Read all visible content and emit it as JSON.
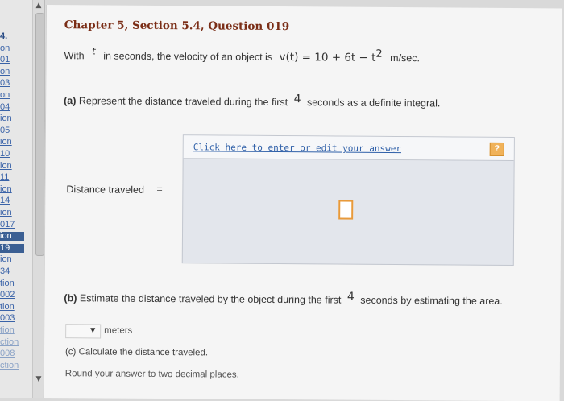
{
  "left_nav": {
    "items": [
      {
        "label": "4.",
        "state": "plain"
      },
      {
        "label": "on",
        "state": "link"
      },
      {
        "label": "01",
        "state": "link"
      },
      {
        "label": "on",
        "state": "link"
      },
      {
        "label": "03",
        "state": "link"
      },
      {
        "label": "on",
        "state": "link"
      },
      {
        "label": "04",
        "state": "link"
      },
      {
        "label": "ion",
        "state": "link"
      },
      {
        "label": "05",
        "state": "link"
      },
      {
        "label": "ion",
        "state": "link"
      },
      {
        "label": "10",
        "state": "link"
      },
      {
        "label": "ion",
        "state": "link"
      },
      {
        "label": "11",
        "state": "link"
      },
      {
        "label": "ion",
        "state": "link"
      },
      {
        "label": "14",
        "state": "link"
      },
      {
        "label": "ion",
        "state": "link"
      },
      {
        "label": "017",
        "state": "link"
      },
      {
        "label": "ion",
        "state": "active"
      },
      {
        "label": "19",
        "state": "active"
      },
      {
        "label": "ion",
        "state": "link"
      },
      {
        "label": "34",
        "state": "link"
      },
      {
        "label": "tion",
        "state": "link"
      },
      {
        "label": "002",
        "state": "link"
      },
      {
        "label": "tion",
        "state": "link"
      },
      {
        "label": "003",
        "state": "link"
      },
      {
        "label": "tion",
        "state": "faded"
      },
      {
        "label": "ction",
        "state": "faded"
      },
      {
        "label": "008",
        "state": "faded"
      },
      {
        "label": "ction",
        "state": "faded"
      }
    ]
  },
  "scrollbar": {
    "up_icon": "▲",
    "down_icon": "▼"
  },
  "question": {
    "title": "Chapter 5, Section 5.4, Question 019",
    "intro_with": "With",
    "var_t": "t",
    "intro_rest": "in seconds, the velocity of an object is",
    "velocity_expr": "v(t) = 10 + 6t − t",
    "exponent": "2",
    "units": "m/sec."
  },
  "part_a": {
    "label": "(a)",
    "text_before": "Represent the distance traveled during the first",
    "number": "4",
    "text_after": "seconds as a definite integral.",
    "field_label": "Distance traveled",
    "equals": "=",
    "edit_link": "Click here to enter or edit your answer",
    "help_icon": "?"
  },
  "part_b": {
    "label": "(b)",
    "text_before": "Estimate the distance traveled by the object during the first",
    "number": "4",
    "text_after": "seconds by estimating the area.",
    "dropdown_value": "",
    "units": "meters"
  },
  "part_c": {
    "label": "(c)",
    "text": "Calculate the distance traveled.",
    "instruction": "Round your answer to two decimal places."
  },
  "colors": {
    "title": "#7a2d16",
    "link": "#2e5fa8",
    "highlight": "#e89a3b",
    "nav_active": "#3b5f93"
  }
}
